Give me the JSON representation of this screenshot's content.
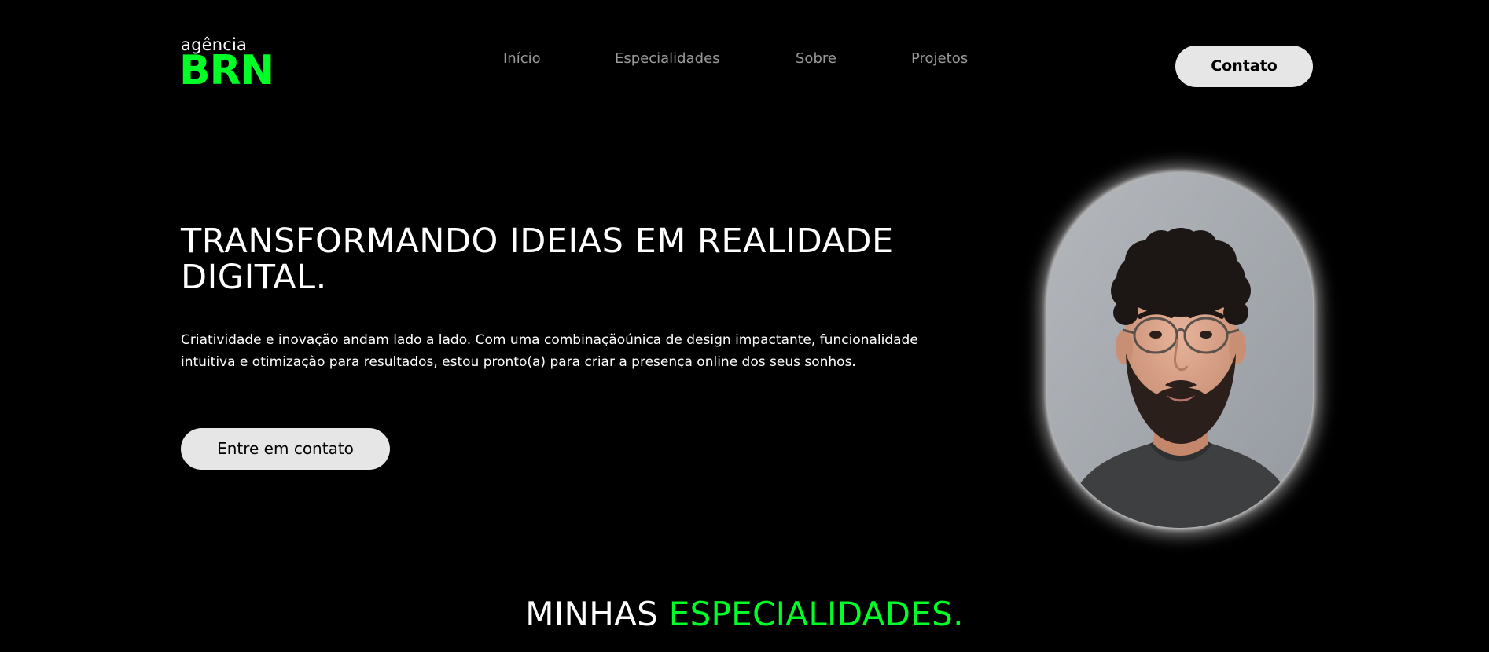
{
  "logo": {
    "small_text": "agência",
    "big_text": "BRN"
  },
  "nav": {
    "items": [
      {
        "label": "Início"
      },
      {
        "label": "Especialidades"
      },
      {
        "label": "Sobre"
      },
      {
        "label": "Projetos"
      }
    ]
  },
  "header": {
    "contact_button": "Contato"
  },
  "hero": {
    "title": "TRANSFORMANDO IDEIAS EM REALIDADE DIGITAL.",
    "description": "Criatividade e inovação andam lado a lado. Com uma combinaçãoúnica de design impactante, funcionalidade intuitiva e otimização para resultados, estou pronto(a) para criar a presença online dos seus sonhos.",
    "cta_button": "Entre em contato"
  },
  "section": {
    "title_part1": "MINHAS",
    "title_part2": "ESPECIALIDADES."
  },
  "colors": {
    "accent": "#00ff26",
    "background": "#000000",
    "button_bg": "#e6e6e6",
    "nav_text": "#9a9a9a"
  }
}
